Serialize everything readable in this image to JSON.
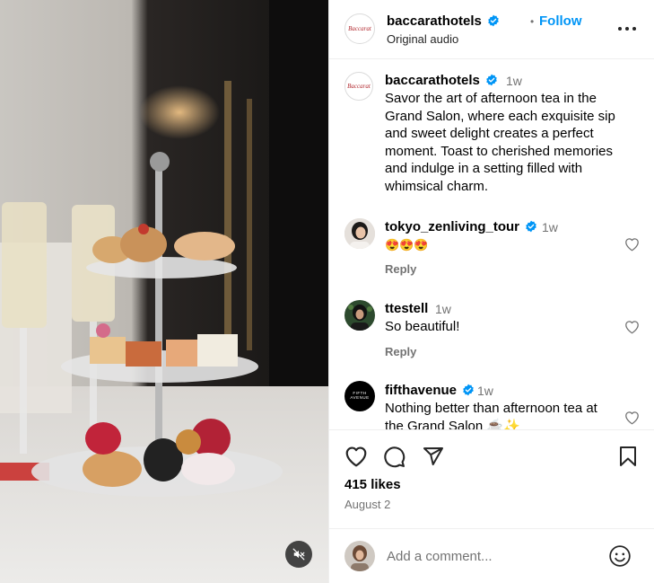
{
  "post": {
    "username": "baccarathotels",
    "logo_text": "Baccarat",
    "follow_label": "Follow",
    "audio_label": "Original audio",
    "dot": "•"
  },
  "caption": {
    "username": "baccarathotels",
    "time": "1w",
    "lines": [
      "Savor the art of afternoon tea in the",
      "Grand Salon, where each exquisite sip",
      "and sweet delight creates a perfect",
      "moment. Toast to cherished memories",
      "and indulge in a setting filled with",
      "whimsical charm."
    ]
  },
  "comments": [
    {
      "username": "tokyo_zenliving_tour",
      "verified": true,
      "time": "1w",
      "text": "😍😍😍",
      "reply_label": "Reply"
    },
    {
      "username": "ttestell",
      "verified": false,
      "time": "1w",
      "text": "So beautiful!",
      "reply_label": "Reply"
    },
    {
      "username": "fifthavenue",
      "verified": true,
      "time": "1w",
      "lines": [
        "Nothing better than afternoon tea at",
        "the Grand Salon ☕✨"
      ],
      "avatar_text": "FIFTH AVENUE"
    }
  ],
  "engagement": {
    "likes": "415 likes",
    "date": "August 2"
  },
  "composer": {
    "placeholder": "Add a comment..."
  },
  "colors": {
    "accent": "#0095f6",
    "verified": "#0095f6",
    "muted": "#737373",
    "logo": "#b1282e"
  },
  "icons": [
    "heart-icon",
    "comment-icon",
    "share-icon",
    "bookmark-icon",
    "more-icon",
    "mute-icon",
    "emoji-icon",
    "verified-icon"
  ]
}
